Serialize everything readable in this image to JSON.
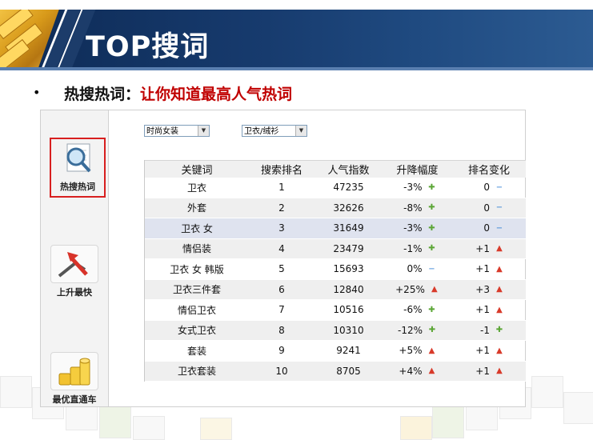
{
  "header": {
    "title": "TOP搜词"
  },
  "bullet": {
    "symbol": "•",
    "prefix": "热搜热词：",
    "highlight": "让你知道最高人气热词"
  },
  "sidebar": {
    "items": [
      {
        "label": "热搜热词",
        "icon": "magnifier-icon",
        "active": true
      },
      {
        "label": "上升最快",
        "icon": "rising-arrow-icon",
        "active": false
      },
      {
        "label": "最优直通车",
        "icon": "gold-coins-icon",
        "active": false
      }
    ]
  },
  "filters": {
    "category": {
      "value": "时尚女装"
    },
    "subcategory": {
      "value": "卫衣/绒衫"
    }
  },
  "table": {
    "columns": [
      "关键词",
      "搜索排名",
      "人气指数",
      "升降幅度",
      "排名变化"
    ],
    "rows": [
      {
        "keyword": "卫衣",
        "rank": "1",
        "index": "47235",
        "change": "-3%",
        "change_dir": "down",
        "rank_change": "0",
        "rank_dir": "flat"
      },
      {
        "keyword": "外套",
        "rank": "2",
        "index": "32626",
        "change": "-8%",
        "change_dir": "down",
        "rank_change": "0",
        "rank_dir": "flat"
      },
      {
        "keyword": "卫衣 女",
        "rank": "3",
        "index": "31649",
        "change": "-3%",
        "change_dir": "down",
        "rank_change": "0",
        "rank_dir": "flat"
      },
      {
        "keyword": "情侣装",
        "rank": "4",
        "index": "23479",
        "change": "-1%",
        "change_dir": "down",
        "rank_change": "+1",
        "rank_dir": "up"
      },
      {
        "keyword": "卫衣 女 韩版",
        "rank": "5",
        "index": "15693",
        "change": "0%",
        "change_dir": "flat",
        "rank_change": "+1",
        "rank_dir": "up"
      },
      {
        "keyword": "卫衣三件套",
        "rank": "6",
        "index": "12840",
        "change": "+25%",
        "change_dir": "up",
        "rank_change": "+3",
        "rank_dir": "up"
      },
      {
        "keyword": "情侣卫衣",
        "rank": "7",
        "index": "10516",
        "change": "-6%",
        "change_dir": "down",
        "rank_change": "+1",
        "rank_dir": "up"
      },
      {
        "keyword": "女式卫衣",
        "rank": "8",
        "index": "10310",
        "change": "-12%",
        "change_dir": "down",
        "rank_change": "-1",
        "rank_dir": "down"
      },
      {
        "keyword": "套装",
        "rank": "9",
        "index": "9241",
        "change": "+5%",
        "change_dir": "up",
        "rank_change": "+1",
        "rank_dir": "up"
      },
      {
        "keyword": "卫衣套装",
        "rank": "10",
        "index": "8705",
        "change": "+4%",
        "change_dir": "up",
        "rank_change": "+1",
        "rank_dir": "up"
      }
    ],
    "highlight_row": 2
  },
  "colors": {
    "banner": "#173b6e",
    "accent_red": "#c00000",
    "active_border": "#d81f1f",
    "up": "#d83a2a",
    "down": "#5aa534",
    "flat": "#2d7dd2"
  }
}
